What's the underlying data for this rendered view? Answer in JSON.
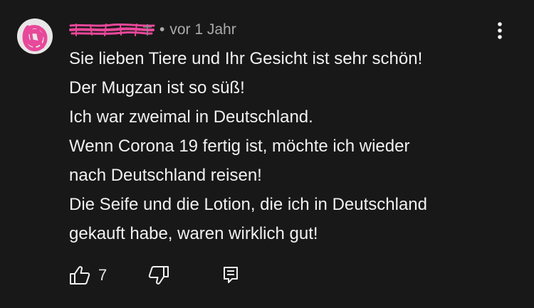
{
  "comment": {
    "author_name": "",
    "timestamp": "vor 1 Jahr",
    "separator": "•",
    "lines": [
      "Sie lieben Tiere und Ihr Gesicht ist sehr schön!",
      "Der Mugzan ist so süß!",
      "Ich war zweimal in Deutschland.",
      "Wenn Corona 19 fertig ist, möchte ich wieder",
      "nach Deutschland reisen!",
      "Die Seife und die Lotion, die ich in Deutschland",
      "gekauft habe, waren wirklich gut!"
    ],
    "like_count": "7"
  },
  "icons": {
    "more": "more-vert-icon",
    "like": "thumbs-up-icon",
    "dislike": "thumbs-down-icon",
    "reply": "reply-comment-icon"
  },
  "colors": {
    "background": "#181818",
    "text": "#f1f1f1",
    "secondary_text": "#aaaaaa",
    "redaction": "#e8489a"
  }
}
